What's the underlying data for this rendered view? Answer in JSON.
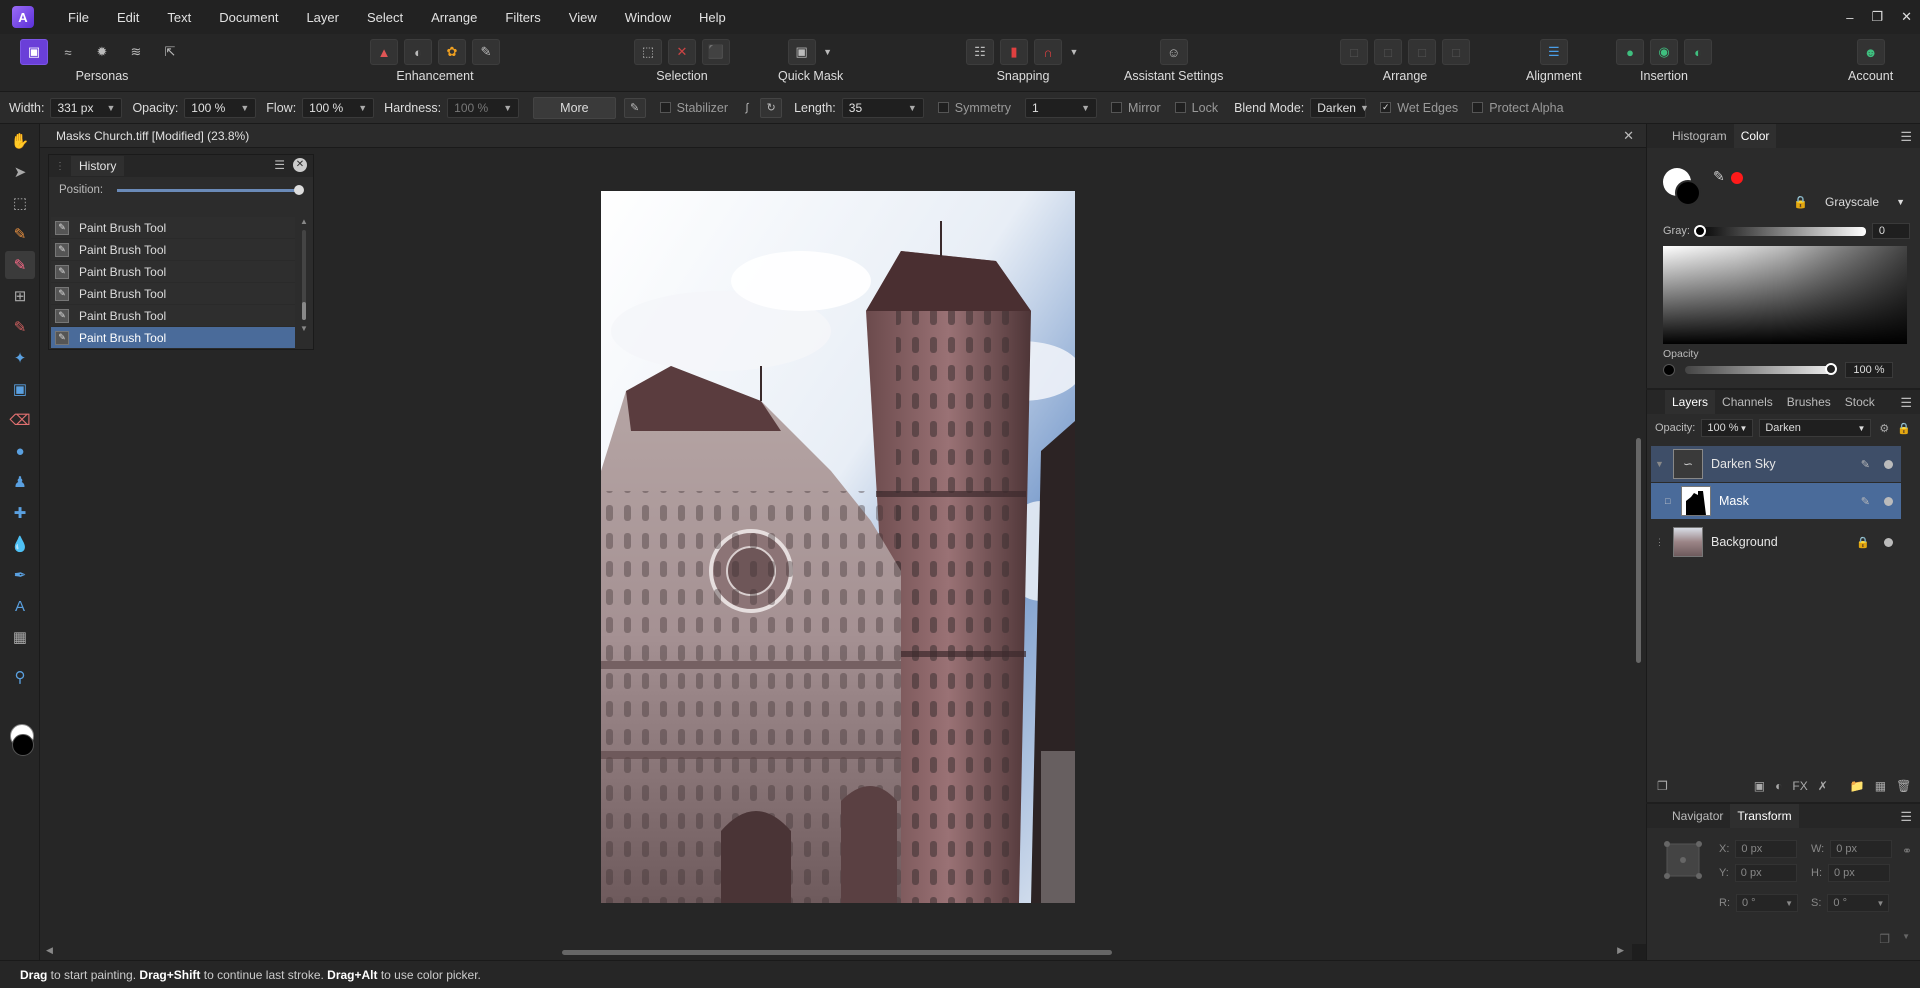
{
  "menubar": {
    "items": [
      "File",
      "Edit",
      "Text",
      "Document",
      "Layer",
      "Select",
      "Arrange",
      "Filters",
      "View",
      "Window",
      "Help"
    ],
    "window_controls": [
      "minimize-icon",
      "restore-icon",
      "close-icon"
    ]
  },
  "toolbar": {
    "personas_label": "Personas",
    "enhancement_label": "Enhancement",
    "selection_label": "Selection",
    "quickmask_label": "Quick Mask",
    "snapping_label": "Snapping",
    "assistant_label": "Assistant Settings",
    "arrange_label": "Arrange",
    "alignment_label": "Alignment",
    "insertion_label": "Insertion",
    "account_label": "Account"
  },
  "context": {
    "width_label": "Width:",
    "width_value": "331 px",
    "opacity_label": "Opacity:",
    "opacity_value": "100 %",
    "flow_label": "Flow:",
    "flow_value": "100 %",
    "hardness_label": "Hardness:",
    "hardness_value": "100 %",
    "more_label": "More",
    "stabilizer_label": "Stabilizer",
    "length_label": "Length:",
    "length_value": "35",
    "symmetry_label": "Symmetry",
    "symmetry_value": "1",
    "mirror_label": "Mirror",
    "lock_label": "Lock",
    "blend_label": "Blend Mode:",
    "blend_value": "Darken",
    "wet_edges_label": "Wet Edges",
    "protect_alpha_label": "Protect Alpha"
  },
  "document": {
    "tab_title": "Masks Church.tiff [Modified] (23.8%)"
  },
  "history": {
    "tab_label": "History",
    "position_label": "Position:",
    "position_fraction": 1.0,
    "items": [
      "Paint Brush Tool",
      "Paint Brush Tool",
      "Paint Brush Tool",
      "Paint Brush Tool",
      "Paint Brush Tool",
      "Paint Brush Tool"
    ],
    "selected_index": 5
  },
  "color_panel": {
    "tabs": [
      "Histogram",
      "Color"
    ],
    "active_tab": "Color",
    "model": "Grayscale",
    "gray_label": "Gray:",
    "gray_value": "0",
    "opacity_label": "Opacity",
    "opacity_value": "100 %",
    "accent_red": "#ff1a1a"
  },
  "layers_panel": {
    "tabs": [
      "Layers",
      "Channels",
      "Brushes",
      "Stock"
    ],
    "active_tab": "Layers",
    "opacity_label": "Opacity:",
    "opacity_value": "100 %",
    "blend_value": "Darken",
    "layers": [
      {
        "name": "Darken Sky",
        "kind": "adjustment"
      },
      {
        "name": "Mask",
        "kind": "mask"
      },
      {
        "name": "Background",
        "kind": "pixel"
      }
    ]
  },
  "transform_panel": {
    "tabs": [
      "Navigator",
      "Transform"
    ],
    "active_tab": "Transform",
    "x_label": "X:",
    "x_value": "0 px",
    "y_label": "Y:",
    "y_value": "0 px",
    "w_label": "W:",
    "w_value": "0 px",
    "h_label": "H:",
    "h_value": "0 px",
    "r_label": "R:",
    "r_value": "0 °",
    "s_label": "S:",
    "s_value": "0 °"
  },
  "status": {
    "drag": "Drag",
    "t1": " to start painting. ",
    "drag_shift": "Drag+Shift",
    "t2": " to continue last stroke. ",
    "drag_alt": "Drag+Alt",
    "t3": " to use color picker."
  }
}
